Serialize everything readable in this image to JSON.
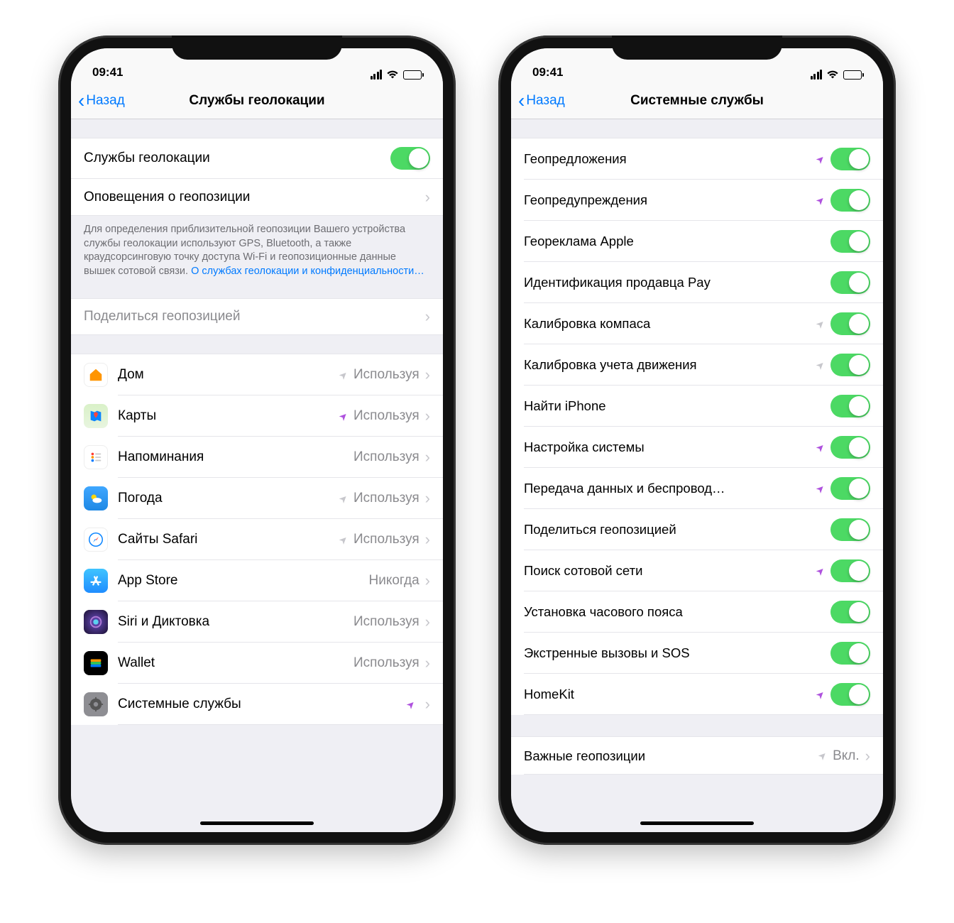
{
  "status": {
    "time": "09:41"
  },
  "phone1": {
    "nav": {
      "back": "Назад",
      "title": "Службы геолокации"
    },
    "main_toggle": {
      "label": "Службы геолокации",
      "on": true
    },
    "alerts_row": {
      "label": "Оповещения о геопозиции"
    },
    "footer": {
      "text": "Для определения приблизительной геопозиции Вашего устройства службы геолокации используют GPS, Bluetooth, а также краудсорсинговую точку доступа Wi-Fi и геопозиционные данные вышек сотовой связи. ",
      "link": "О службах геолокации и конфиденциальности…"
    },
    "share_row": {
      "label": "Поделиться геопозицией"
    },
    "apps": [
      {
        "name": "Дом",
        "status": "Используя",
        "arrow": "gray",
        "icon": "home"
      },
      {
        "name": "Карты",
        "status": "Используя",
        "arrow": "purple",
        "icon": "maps"
      },
      {
        "name": "Напоминания",
        "status": "Используя",
        "arrow": "",
        "icon": "reminders"
      },
      {
        "name": "Погода",
        "status": "Используя",
        "arrow": "gray",
        "icon": "weather"
      },
      {
        "name": "Сайты Safari",
        "status": "Используя",
        "arrow": "gray",
        "icon": "safari"
      },
      {
        "name": "App Store",
        "status": "Никогда",
        "arrow": "",
        "icon": "appstore"
      },
      {
        "name": "Siri и Диктовка",
        "status": "Используя",
        "arrow": "",
        "icon": "siri"
      },
      {
        "name": "Wallet",
        "status": "Используя",
        "arrow": "",
        "icon": "wallet"
      },
      {
        "name": "Системные службы",
        "status": "",
        "arrow": "purple",
        "icon": "gear"
      }
    ]
  },
  "phone2": {
    "nav": {
      "back": "Назад",
      "title": "Системные службы"
    },
    "items1": [
      {
        "name": "Геопредложения",
        "arrow": "purple",
        "toggle": true
      },
      {
        "name": "Геопредупреждения",
        "arrow": "purple",
        "toggle": true
      },
      {
        "name": "Геореклама Apple",
        "arrow": "",
        "toggle": true
      },
      {
        "name": "Идентификация продавца Pay",
        "arrow": "",
        "toggle": true
      },
      {
        "name": "Калибровка компаса",
        "arrow": "gray",
        "toggle": true
      },
      {
        "name": "Калибровка учета движения",
        "arrow": "gray",
        "toggle": true
      },
      {
        "name": "Найти iPhone",
        "arrow": "",
        "toggle": true
      },
      {
        "name": "Настройка системы",
        "arrow": "purple",
        "toggle": true
      },
      {
        "name": "Передача данных и беспровод…",
        "arrow": "purple",
        "toggle": true
      },
      {
        "name": "Поделиться геопозицией",
        "arrow": "",
        "toggle": true
      },
      {
        "name": "Поиск сотовой сети",
        "arrow": "purple",
        "toggle": true
      },
      {
        "name": "Установка часового пояса",
        "arrow": "",
        "toggle": true
      },
      {
        "name": "Экстренные вызовы и SOS",
        "arrow": "",
        "toggle": true
      },
      {
        "name": "HomeKit",
        "arrow": "purple",
        "toggle": true
      }
    ],
    "items2": [
      {
        "name": "Важные геопозиции",
        "arrow": "gray",
        "status": "Вкл."
      }
    ]
  }
}
